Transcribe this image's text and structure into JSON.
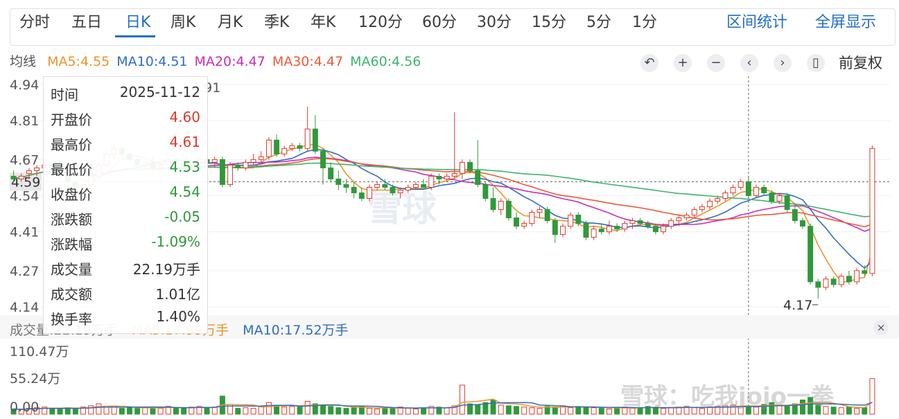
{
  "tabs": [
    {
      "label": "分时",
      "x": 28
    },
    {
      "label": "五日",
      "x": 103
    },
    {
      "label": "日K",
      "x": 181
    },
    {
      "label": "周K",
      "x": 246
    },
    {
      "label": "月K",
      "x": 314
    },
    {
      "label": "季K",
      "x": 381
    },
    {
      "label": "年K",
      "x": 448
    },
    {
      "label": "120分",
      "x": 517
    },
    {
      "label": "60分",
      "x": 609
    },
    {
      "label": "30分",
      "x": 688
    },
    {
      "label": "15分",
      "x": 767
    },
    {
      "label": "5分",
      "x": 846
    },
    {
      "label": "1分",
      "x": 912
    }
  ],
  "active_tab": "日K",
  "right_tabs": {
    "range_stats": "区间统计",
    "fullscreen": "全屏显示"
  },
  "ma_header": {
    "label": "均线",
    "items": [
      {
        "text": "MA5:4.55",
        "color": "#f0922d"
      },
      {
        "text": "MA10:4.51",
        "color": "#2f6dc3"
      },
      {
        "text": "MA20:4.47",
        "color": "#c72fb4"
      },
      {
        "text": "MA30:4.47",
        "color": "#ea5a3a"
      },
      {
        "text": "MA60:4.56",
        "color": "#3db46e"
      }
    ]
  },
  "controls": {
    "undo": "↶",
    "zoom_in": "+",
    "zoom_out": "−",
    "prev": "‹",
    "next": "›",
    "candle": "▯",
    "adjust": "前复权"
  },
  "tooltip": [
    {
      "k": "时间",
      "v": "2025-11-12",
      "c": "#333"
    },
    {
      "k": "开盘价",
      "v": "4.60",
      "c": "#e0392b"
    },
    {
      "k": "最高价",
      "v": "4.61",
      "c": "#e0392b"
    },
    {
      "k": "最低价",
      "v": "4.53",
      "c": "#2e9a3a"
    },
    {
      "k": "收盘价",
      "v": "4.54",
      "c": "#2e9a3a"
    },
    {
      "k": "涨跌额",
      "v": "-0.05",
      "c": "#2e9a3a"
    },
    {
      "k": "涨跌幅",
      "v": "-1.09%",
      "c": "#2e9a3a"
    },
    {
      "k": "成交量",
      "v": "22.19万手",
      "c": "#333"
    },
    {
      "k": "成交额",
      "v": "1.01亿",
      "c": "#333"
    },
    {
      "k": "换手率",
      "v": "1.40%",
      "c": "#333"
    }
  ],
  "volume_header": {
    "vol": "成交量:22.19万手",
    "ma5": "MA5:17.99万手",
    "ma10": "MA10:17.52万手"
  },
  "annotations": {
    "low": "4.17",
    "high_partial": "4.91",
    "close": "×"
  },
  "watermark": "雪球",
  "watermark2": "雪球：吃我jojo一拳",
  "chart_data": {
    "type": "candlestick",
    "price_axis": {
      "labels": [
        "4.94",
        "4.81",
        "4.67",
        "4.54",
        "4.41",
        "4.27",
        "4.14"
      ],
      "crosshair_label": "4.59",
      "ylim": [
        4.14,
        4.94
      ]
    },
    "volume_axis": {
      "labels": [
        "110.47万",
        "55.24万",
        "0.00"
      ],
      "ylim": [
        0,
        110.47
      ]
    },
    "up_color": "#e0392b",
    "down_color": "#2e9a3a",
    "candles": [
      [
        4.61,
        4.63,
        4.59,
        4.6
      ],
      [
        4.6,
        4.62,
        4.59,
        4.61
      ],
      [
        4.62,
        4.64,
        4.6,
        4.63
      ],
      [
        4.63,
        4.65,
        4.61,
        4.64
      ],
      [
        4.64,
        4.67,
        4.62,
        4.65
      ],
      [
        4.65,
        4.66,
        4.62,
        4.63
      ],
      [
        4.63,
        4.64,
        4.6,
        4.61
      ],
      [
        4.61,
        4.62,
        4.58,
        4.59
      ],
      [
        4.59,
        4.6,
        4.56,
        4.57
      ],
      [
        4.57,
        4.59,
        4.56,
        4.58
      ],
      [
        4.58,
        4.62,
        4.57,
        4.61
      ],
      [
        4.61,
        4.66,
        4.6,
        4.65
      ],
      [
        4.65,
        4.7,
        4.64,
        4.69
      ],
      [
        4.69,
        4.73,
        4.67,
        4.71
      ],
      [
        4.71,
        4.72,
        4.68,
        4.69
      ],
      [
        4.69,
        4.7,
        4.66,
        4.67
      ],
      [
        4.67,
        4.68,
        4.64,
        4.65
      ],
      [
        4.65,
        4.66,
        4.63,
        4.66
      ],
      [
        4.66,
        4.68,
        4.64,
        4.64
      ],
      [
        4.64,
        4.66,
        4.63,
        4.65
      ],
      [
        4.65,
        4.68,
        4.64,
        4.67
      ],
      [
        4.67,
        4.68,
        4.65,
        4.66
      ],
      [
        4.66,
        4.67,
        4.63,
        4.64
      ],
      [
        4.64,
        4.67,
        4.63,
        4.66
      ],
      [
        4.66,
        4.68,
        4.65,
        4.67
      ],
      [
        4.67,
        4.68,
        4.65,
        4.66
      ],
      [
        4.66,
        4.68,
        4.64,
        4.67
      ],
      [
        4.67,
        4.68,
        4.57,
        4.58
      ],
      [
        4.58,
        4.66,
        4.57,
        4.65
      ],
      [
        4.65,
        4.66,
        4.63,
        4.64
      ],
      [
        4.64,
        4.67,
        4.63,
        4.66
      ],
      [
        4.66,
        4.69,
        4.65,
        4.67
      ],
      [
        4.67,
        4.7,
        4.66,
        4.68
      ],
      [
        4.68,
        4.75,
        4.67,
        4.74
      ],
      [
        4.74,
        4.76,
        4.68,
        4.69
      ],
      [
        4.69,
        4.72,
        4.68,
        4.71
      ],
      [
        4.71,
        4.73,
        4.7,
        4.72
      ],
      [
        4.72,
        4.73,
        4.7,
        4.71
      ],
      [
        4.71,
        4.86,
        4.7,
        4.78
      ],
      [
        4.78,
        4.83,
        4.69,
        4.7
      ],
      [
        4.7,
        4.71,
        4.58,
        4.64
      ],
      [
        4.64,
        4.66,
        4.59,
        4.6
      ],
      [
        4.6,
        4.63,
        4.56,
        4.58
      ],
      [
        4.58,
        4.6,
        4.55,
        4.57
      ],
      [
        4.57,
        4.59,
        4.53,
        4.55
      ],
      [
        4.55,
        4.57,
        4.52,
        4.53
      ],
      [
        4.53,
        4.58,
        4.52,
        4.57
      ],
      [
        4.57,
        4.59,
        4.56,
        4.58
      ],
      [
        4.58,
        4.6,
        4.56,
        4.57
      ],
      [
        4.57,
        4.58,
        4.54,
        4.55
      ],
      [
        4.55,
        4.57,
        4.53,
        4.56
      ],
      [
        4.56,
        4.58,
        4.55,
        4.57
      ],
      [
        4.57,
        4.59,
        4.56,
        4.58
      ],
      [
        4.58,
        4.6,
        4.57,
        4.57
      ],
      [
        4.57,
        4.62,
        4.56,
        4.61
      ],
      [
        4.61,
        4.62,
        4.58,
        4.6
      ],
      [
        4.6,
        4.62,
        4.59,
        4.61
      ],
      [
        4.61,
        4.84,
        4.6,
        4.62
      ],
      [
        4.62,
        4.67,
        4.6,
        4.66
      ],
      [
        4.66,
        4.67,
        4.62,
        4.63
      ],
      [
        4.63,
        4.74,
        4.57,
        4.58
      ],
      [
        4.58,
        4.59,
        4.52,
        4.53
      ],
      [
        4.53,
        4.57,
        4.48,
        4.49
      ],
      [
        4.49,
        4.53,
        4.47,
        4.52
      ],
      [
        4.52,
        4.53,
        4.45,
        4.46
      ],
      [
        4.46,
        4.48,
        4.42,
        4.43
      ],
      [
        4.43,
        4.45,
        4.42,
        4.44
      ],
      [
        4.44,
        4.49,
        4.43,
        4.48
      ],
      [
        4.48,
        4.5,
        4.46,
        4.49
      ],
      [
        4.49,
        4.5,
        4.44,
        4.45
      ],
      [
        4.45,
        4.46,
        4.37,
        4.4
      ],
      [
        4.4,
        4.44,
        4.39,
        4.43
      ],
      [
        4.43,
        4.48,
        4.42,
        4.47
      ],
      [
        4.47,
        4.48,
        4.43,
        4.44
      ],
      [
        4.44,
        4.45,
        4.38,
        4.39
      ],
      [
        4.39,
        4.43,
        4.38,
        4.42
      ],
      [
        4.42,
        4.44,
        4.4,
        4.41
      ],
      [
        4.41,
        4.45,
        4.4,
        4.43
      ],
      [
        4.43,
        4.44,
        4.41,
        4.42
      ],
      [
        4.42,
        4.45,
        4.41,
        4.44
      ],
      [
        4.44,
        4.46,
        4.42,
        4.45
      ],
      [
        4.45,
        4.46,
        4.43,
        4.44
      ],
      [
        4.44,
        4.45,
        4.42,
        4.43
      ],
      [
        4.43,
        4.44,
        4.4,
        4.41
      ],
      [
        4.41,
        4.44,
        4.4,
        4.43
      ],
      [
        4.43,
        4.46,
        4.42,
        4.45
      ],
      [
        4.45,
        4.47,
        4.43,
        4.46
      ],
      [
        4.46,
        4.48,
        4.45,
        4.47
      ],
      [
        4.47,
        4.5,
        4.46,
        4.49
      ],
      [
        4.49,
        4.51,
        4.48,
        4.5
      ],
      [
        4.5,
        4.53,
        4.49,
        4.52
      ],
      [
        4.52,
        4.54,
        4.51,
        4.53
      ],
      [
        4.53,
        4.56,
        4.52,
        4.55
      ],
      [
        4.55,
        4.58,
        4.54,
        4.57
      ],
      [
        4.57,
        4.6,
        4.56,
        4.59
      ],
      [
        4.59,
        4.61,
        4.53,
        4.54
      ],
      [
        4.54,
        4.58,
        4.53,
        4.57
      ],
      [
        4.57,
        4.58,
        4.54,
        4.55
      ],
      [
        4.55,
        4.56,
        4.51,
        4.52
      ],
      [
        4.52,
        4.55,
        4.51,
        4.54
      ],
      [
        4.54,
        4.55,
        4.48,
        4.49
      ],
      [
        4.49,
        4.51,
        4.44,
        4.45
      ],
      [
        4.45,
        4.46,
        4.42,
        4.43
      ],
      [
        4.43,
        4.44,
        4.22,
        4.23
      ],
      [
        4.23,
        4.24,
        4.17,
        4.21
      ],
      [
        4.21,
        4.25,
        4.2,
        4.24
      ],
      [
        4.24,
        4.25,
        4.21,
        4.22
      ],
      [
        4.22,
        4.26,
        4.21,
        4.25
      ],
      [
        4.25,
        4.27,
        4.22,
        4.23
      ],
      [
        4.23,
        4.28,
        4.22,
        4.27
      ],
      [
        4.27,
        4.29,
        4.25,
        4.26
      ],
      [
        4.26,
        4.72,
        4.25,
        4.71
      ]
    ],
    "volume": [
      8,
      7,
      9,
      10,
      11,
      9,
      8,
      10,
      9,
      11,
      13,
      16,
      12,
      11,
      9,
      10,
      9,
      10,
      11,
      9,
      12,
      10,
      9,
      11,
      12,
      10,
      11,
      28,
      15,
      9,
      10,
      9,
      12,
      18,
      14,
      11,
      12,
      11,
      20,
      16,
      14,
      12,
      10,
      9,
      10,
      12,
      9,
      8,
      9,
      10,
      11,
      9,
      8,
      10,
      12,
      11,
      10,
      13,
      45,
      16,
      15,
      18,
      22,
      14,
      13,
      12,
      11,
      10,
      9,
      12,
      11,
      13,
      10,
      12,
      11,
      10,
      9,
      8,
      10,
      11,
      9,
      10,
      12,
      11,
      9,
      10,
      11,
      12,
      10,
      9,
      11,
      12,
      13,
      14,
      12,
      13,
      11,
      15,
      18,
      13,
      12,
      16,
      22,
      26,
      14,
      12,
      11,
      10,
      11,
      9,
      10,
      55
    ],
    "volume_up_color": "#e0392b",
    "volume_down_color": "#2e9a3a",
    "ma_vol_colors": {
      "ma5": "#f0922d",
      "ma10": "#2f6dc3"
    },
    "ma_series": [
      {
        "name": "MA5",
        "color": "#f0922d",
        "period": 5
      },
      {
        "name": "MA10",
        "color": "#2f6dc3",
        "period": 10
      },
      {
        "name": "MA20",
        "color": "#c72fb4",
        "period": 20
      },
      {
        "name": "MA30",
        "color": "#ea5a3a",
        "period": 30
      },
      {
        "name": "MA60",
        "color": "#3db46e",
        "period": 60
      }
    ],
    "crosshair_index": 95
  }
}
